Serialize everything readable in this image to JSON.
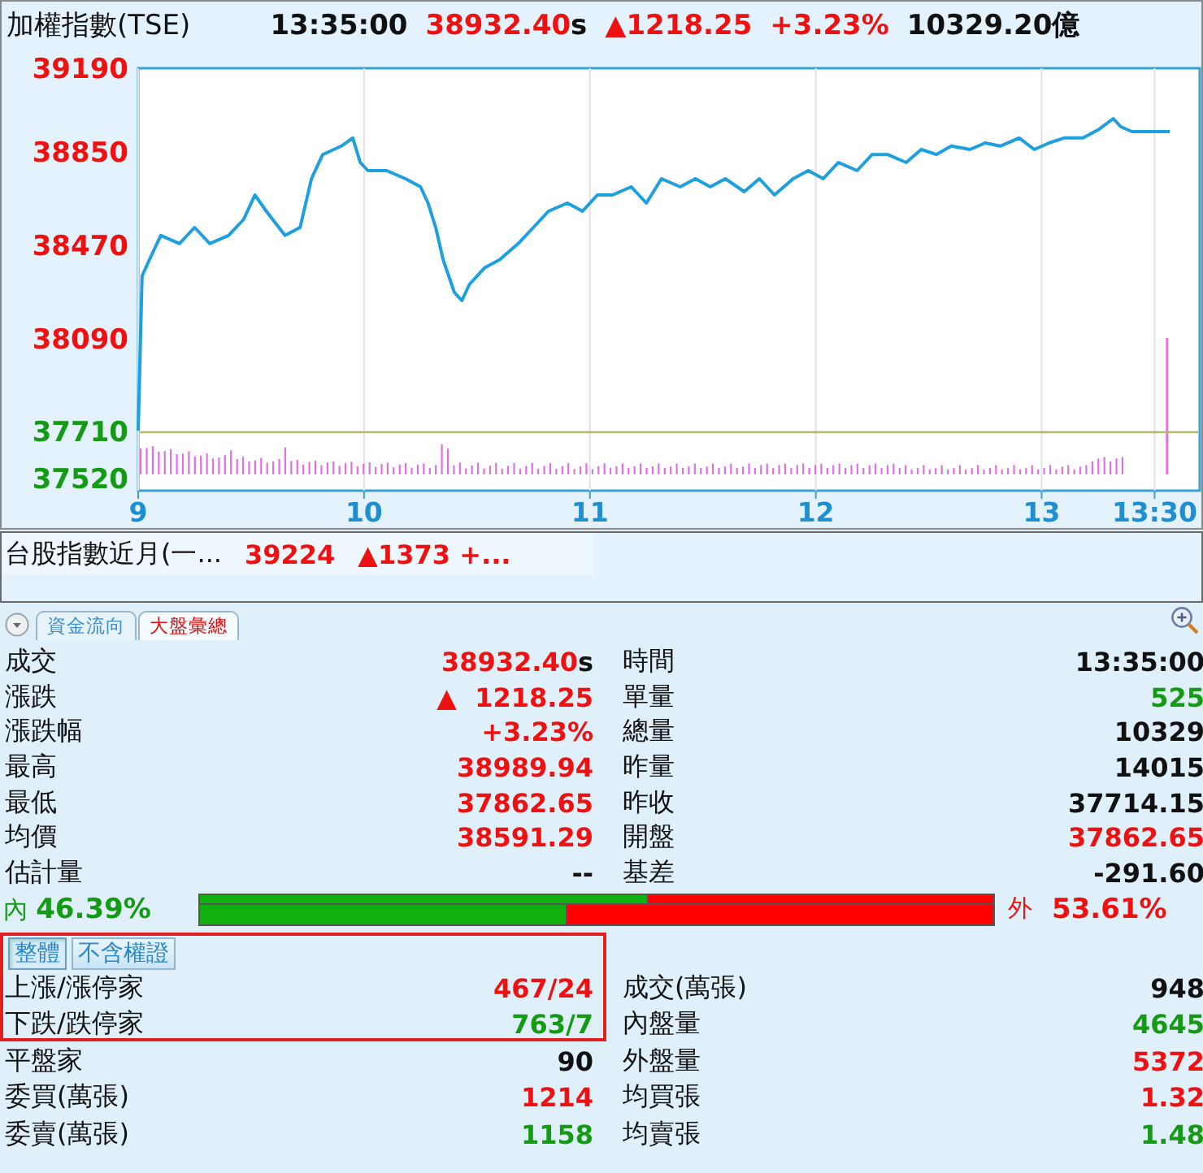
{
  "header": {
    "items": [
      {
        "text": "加權指數(TSE)",
        "kind": "name",
        "color": "#111111"
      },
      {
        "text": "13:35:00",
        "kind": "quote",
        "color": "#111111"
      },
      {
        "text": "38932.40",
        "kind": "quote",
        "color": "#ee1111",
        "suffix": "s"
      },
      {
        "text": "▲1218.25",
        "kind": "quote",
        "color": "#ee1111"
      },
      {
        "text": "+3.23%",
        "kind": "quote",
        "color": "#ee1111"
      },
      {
        "text": "10329.20億",
        "kind": "quote",
        "color": "#111111"
      }
    ]
  },
  "chart": {
    "chart_data": {
      "type": "line",
      "grid": true,
      "xlim": [
        9,
        13.7
      ],
      "ylim": [
        37470,
        39190
      ],
      "yticks": [
        39190,
        38850,
        38470,
        38090,
        37710,
        37520
      ],
      "xticks": [
        9,
        10,
        11,
        12,
        13,
        {
          "value": 13.5,
          "label": "13:30"
        }
      ],
      "x": [
        9,
        9.017,
        9.05,
        9.1,
        9.183,
        9.25,
        9.317,
        9.4,
        9.467,
        9.517,
        9.567,
        9.65,
        9.717,
        9.767,
        9.817,
        9.9,
        9.95,
        9.983,
        10.017,
        10.1,
        10.183,
        10.25,
        10.283,
        10.317,
        10.35,
        10.4,
        10.433,
        10.467,
        10.533,
        10.6,
        10.683,
        10.75,
        10.817,
        10.9,
        10.967,
        11.033,
        11.1,
        11.183,
        11.25,
        11.317,
        11.4,
        11.467,
        11.533,
        11.6,
        11.683,
        11.75,
        11.817,
        11.9,
        11.967,
        12.033,
        12.1,
        12.183,
        12.25,
        12.317,
        12.4,
        12.467,
        12.533,
        12.6,
        12.683,
        12.75,
        12.817,
        12.9,
        12.967,
        13.033,
        13.1,
        13.183,
        13.25,
        13.317,
        13.35,
        13.4,
        13.567
      ],
      "series": [
        {
          "color": "#1e9fdf",
          "values": [
            37714,
            38344,
            38410,
            38509,
            38476,
            38542,
            38476,
            38509,
            38575,
            38674,
            38608,
            38509,
            38542,
            38740,
            38839,
            38873,
            38906,
            38806,
            38773,
            38773,
            38740,
            38707,
            38641,
            38542,
            38410,
            38277,
            38244,
            38310,
            38377,
            38410,
            38476,
            38542,
            38608,
            38641,
            38608,
            38674,
            38674,
            38707,
            38641,
            38740,
            38707,
            38740,
            38707,
            38740,
            38687,
            38740,
            38674,
            38740,
            38773,
            38740,
            38806,
            38773,
            38839,
            38839,
            38806,
            38859,
            38839,
            38873,
            38859,
            38886,
            38873,
            38906,
            38859,
            38886,
            38906,
            38906,
            38939,
            38985,
            38952,
            38932,
            38932
          ]
        }
      ]
    }
  },
  "futures": {
    "items": [
      {
        "text": "台股指數近月(一...",
        "kind": "name",
        "color": "#111111"
      },
      {
        "text": "39224",
        "kind": "quote",
        "color": "#ee1111"
      },
      {
        "text": "▲1373 +...",
        "kind": "quote",
        "color": "#ee1111"
      }
    ]
  },
  "tabs": [
    {
      "label": "資金流向",
      "selected": false
    },
    {
      "label": "大盤彙總",
      "selected": true
    }
  ],
  "stats": {
    "left": [
      {
        "label": "成交",
        "value": "38932.40",
        "suffix": "s",
        "color": "#ee1111"
      },
      {
        "label": "漲跌",
        "value": "▲  1218.25",
        "color": "#ee1111"
      },
      {
        "label": "漲跌幅",
        "value": "+3.23%",
        "color": "#ee1111"
      },
      {
        "label": "最高",
        "value": "38989.94",
        "color": "#ee1111"
      },
      {
        "label": "最低",
        "value": "37862.65",
        "color": "#ee1111"
      },
      {
        "label": "均價",
        "value": "38591.29",
        "color": "#ee1111"
      },
      {
        "label": "估計量",
        "value": "--",
        "color": "#111111"
      }
    ],
    "right": [
      {
        "label": "時間",
        "value": "13:35:00",
        "color": "#111111"
      },
      {
        "label": "單量",
        "value": "525",
        "color": "#159a15"
      },
      {
        "label": "總量",
        "value": "10329",
        "color": "#111111"
      },
      {
        "label": "昨量",
        "value": "14015",
        "color": "#111111"
      },
      {
        "label": "昨收",
        "value": "37714.15",
        "color": "#111111"
      },
      {
        "label": "開盤",
        "value": "37862.65",
        "color": "#ee1111"
      },
      {
        "label": "基差",
        "value": "-291.60",
        "color": "#111111"
      }
    ]
  },
  "ratio": {
    "inner_label": "內",
    "inner_value": "46.39%",
    "outer_label": "外",
    "outer_value": "53.61%",
    "bars": [
      {
        "level": 0.565
      },
      {
        "level": 0.4639
      }
    ]
  },
  "breadth": {
    "highlight": true,
    "tabs": [
      {
        "label": "整體",
        "selected": true
      },
      {
        "label": "不含權證",
        "selected": false
      }
    ],
    "left": [
      {
        "label": "上漲/漲停家",
        "value": "467/24",
        "color": "#ee1111"
      },
      {
        "label": "下跌/跌停家",
        "value": "763/7",
        "color": "#159a15"
      },
      {
        "label": "平盤家",
        "value": "90",
        "color": "#111111"
      },
      {
        "label": "委買(萬張)",
        "value": "1214",
        "color": "#ee1111"
      },
      {
        "label": "委賣(萬張)",
        "value": "1158",
        "color": "#159a15"
      }
    ],
    "right": [
      {
        "label": "成交(萬張)",
        "value": "948",
        "color": "#111111"
      },
      {
        "label": "內盤量",
        "value": "4645",
        "color": "#159a15"
      },
      {
        "label": "外盤量",
        "value": "5372",
        "color": "#ee1111"
      },
      {
        "label": "均買張",
        "value": "1.32",
        "color": "#ee1111"
      },
      {
        "label": "均賣張",
        "value": "1.48",
        "color": "#159a15"
      }
    ]
  }
}
